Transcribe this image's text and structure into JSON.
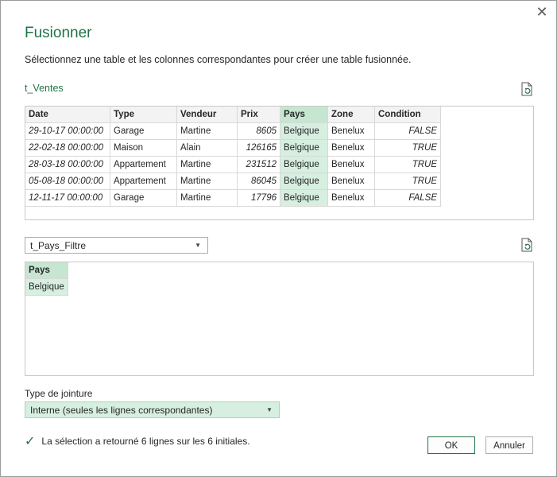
{
  "dialog": {
    "title": "Fusionner",
    "subtitle": "Sélectionnez une table et les colonnes correspondantes pour créer une table fusionnée.",
    "close_icon": "close-icon"
  },
  "top_table": {
    "name": "t_Ventes",
    "columns": [
      "Date",
      "Type",
      "Vendeur",
      "Prix",
      "Pays",
      "Zone",
      "Condition"
    ],
    "rows": [
      [
        "29-10-17 00:00:00",
        "Garage",
        "Martine",
        "8605",
        "Belgique",
        "Benelux",
        "FALSE"
      ],
      [
        "22-02-18 00:00:00",
        "Maison",
        "Alain",
        "126165",
        "Belgique",
        "Benelux",
        "TRUE"
      ],
      [
        "28-03-18 00:00:00",
        "Appartement",
        "Martine",
        "231512",
        "Belgique",
        "Benelux",
        "TRUE"
      ],
      [
        "05-08-18 00:00:00",
        "Appartement",
        "Martine",
        "86045",
        "Belgique",
        "Benelux",
        "TRUE"
      ],
      [
        "12-11-17 00:00:00",
        "Garage",
        "Martine",
        "17796",
        "Belgique",
        "Benelux",
        "FALSE"
      ]
    ]
  },
  "second_table": {
    "selected": "t_Pays_Filtre",
    "columns": [
      "Pays"
    ],
    "rows": [
      [
        "Belgique"
      ]
    ]
  },
  "join": {
    "label": "Type de jointure",
    "selected": "Interne (seules les lignes correspondantes)"
  },
  "status": "La sélection a retourné 6 lignes sur les 6 initiales.",
  "buttons": {
    "ok": "OK",
    "cancel": "Annuler"
  },
  "colors": {
    "accent": "#217346",
    "selected_column": "#d7efe0"
  }
}
